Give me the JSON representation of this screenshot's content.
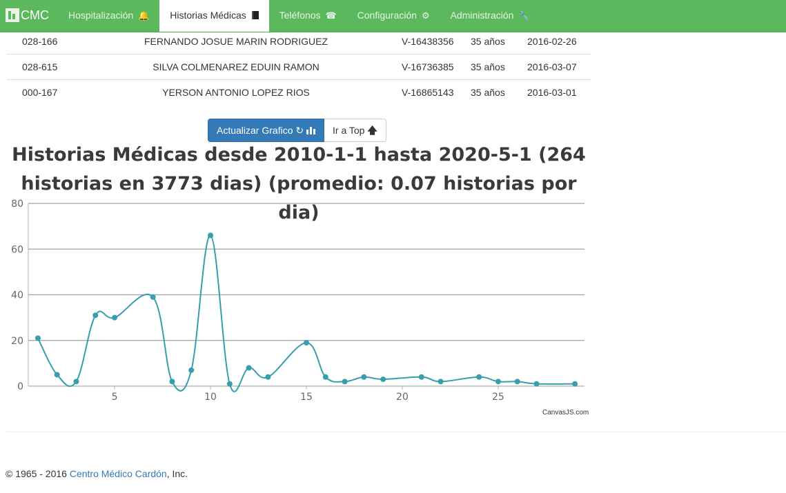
{
  "navbar": {
    "brand": "CMC",
    "items": [
      {
        "label": "Hospitalización",
        "icon": "bell-icon"
      },
      {
        "label": "Historias Médicas",
        "icon": "book-icon",
        "active": true
      },
      {
        "label": "Teléfonos",
        "icon": "phone-icon"
      },
      {
        "label": "Configuración",
        "icon": "gear-icon"
      },
      {
        "label": "Administración",
        "icon": "wrench-icon"
      }
    ]
  },
  "table": {
    "rows": [
      [
        "028-166",
        "FERNANDO JOSUE MARIN RODRIGUEZ",
        "V-16438356",
        "35 años",
        "2016-02-26"
      ],
      [
        "028-615",
        "SILVA COLMENAREZ EDUIN RAMON",
        "V-16736385",
        "35 años",
        "2016-03-07"
      ],
      [
        "000-167",
        "YERSON ANTONIO LOPEZ RIOS",
        "V-16865143",
        "35 años",
        "2016-03-01"
      ]
    ]
  },
  "buttons": {
    "update_chart": "Actualizar Grafico",
    "go_top": "Ir a Top"
  },
  "chart_data": {
    "type": "line",
    "title": "Historias Médicas desde 2010-1-1 hasta 2020-5-1 (264 historias en 3773 dias) (promedio: 0.07 historias por dia)",
    "x": [
      1,
      2,
      3,
      4,
      5,
      6,
      7,
      8,
      9,
      10,
      11,
      12,
      13,
      14,
      15,
      16,
      17,
      18,
      19,
      20,
      21,
      22,
      23,
      24,
      25,
      26,
      27,
      28,
      29
    ],
    "values": [
      21,
      5,
      2,
      31,
      30,
      null,
      39,
      2,
      7,
      66,
      1,
      8,
      4,
      null,
      19,
      4,
      2,
      4,
      3,
      null,
      4,
      2,
      null,
      4,
      2,
      2,
      1,
      null,
      1
    ],
    "xticks": [
      5,
      10,
      15,
      20,
      25
    ],
    "yticks": [
      0,
      20,
      40,
      60,
      80
    ],
    "xlim": [
      0.5,
      29.5
    ],
    "ylim": [
      0,
      80
    ],
    "color": "#369ead",
    "grid": true,
    "credit": "CanvasJS.com"
  },
  "footer": {
    "prefix": "© 1965 - 2016 ",
    "link": "Centro Médico Cardón",
    "suffix": ", Inc."
  }
}
